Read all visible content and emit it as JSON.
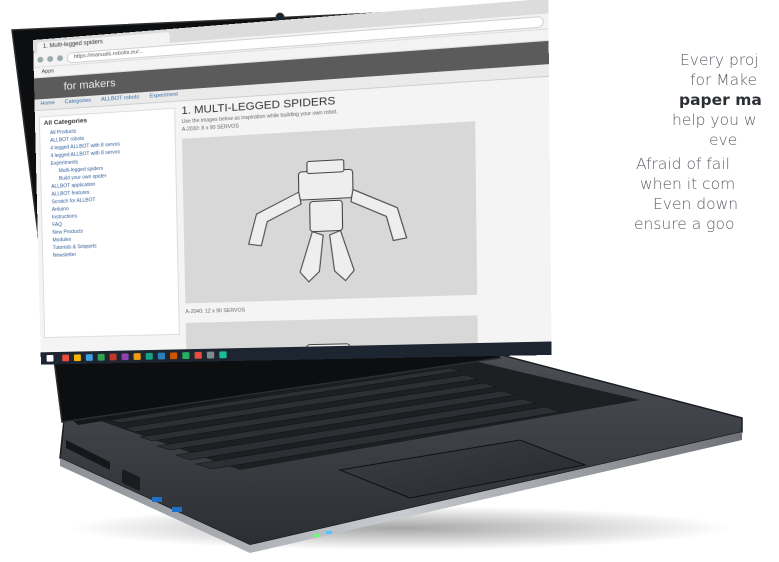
{
  "side_copy": {
    "line1": "Every proj",
    "line2": "for Make",
    "line3": "paper ma",
    "line4": "help you w",
    "line5": "eve",
    "line6": "Afraid of fail",
    "line7": "when it com",
    "line8": "Even down",
    "line9": "ensure a goo"
  },
  "screen": {
    "tab_title": "1. Multi-legged spiders",
    "address": "https://manuals.robotis.eu/...",
    "bookmarks": "Apps",
    "banner": "for makers",
    "menu": [
      "Home",
      "Categories",
      "ALLBOT robots",
      "Experiment"
    ],
    "sidebar_header": "All Categories",
    "sidebar_items": [
      "All Products",
      "ALLBOT robots",
      "4 legged ALLBOT with 8 servos",
      "4 legged ALLBOT with 8 servos",
      "Experiments",
      "Multi-legged spiders",
      "Build your own spider",
      "ALLBOT application",
      "ALLBOT features",
      "Scratch for ALLBOT",
      "Arduino",
      "Instructions",
      "FAQ",
      "New Products",
      "Modules",
      "Tutorials & Snippets",
      "Newsletter"
    ],
    "page_title": "1. MULTI-LEGGED SPIDERS",
    "page_sub": "Use the images below as inspiration while building your own robot.",
    "fig1_caption": "A-2030: 8 x 90 SERVOS",
    "fig2_caption": "A-2040: 12 x 90 SERVOS"
  },
  "colors": {
    "laptop_body": "#2a2d31",
    "bezel": "#0d0e10",
    "deck": "#3a3d42",
    "screen_banner": "#5b5b5b",
    "taskbar": "#1d2530"
  }
}
